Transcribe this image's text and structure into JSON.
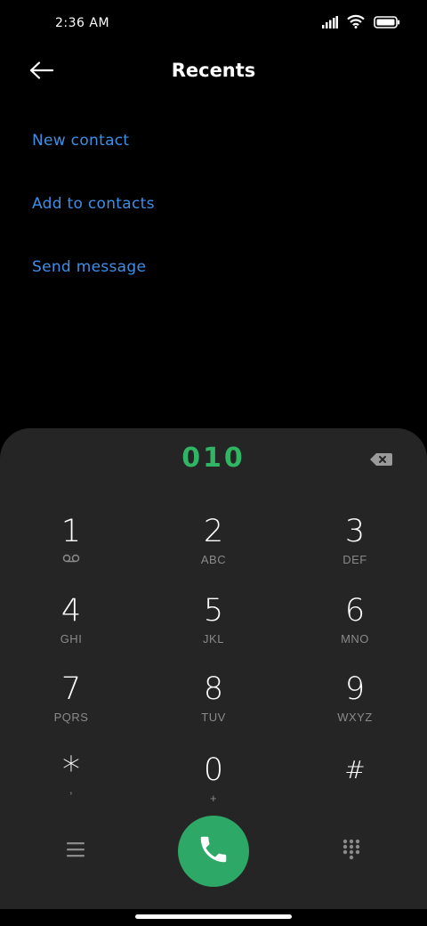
{
  "status_bar": {
    "time": "2:36 AM"
  },
  "header": {
    "title": "Recents"
  },
  "actions": {
    "new_contact": "New contact",
    "add_to_contacts": "Add to contacts",
    "send_message": "Send message"
  },
  "dialer": {
    "number": "010",
    "keys": [
      {
        "digit": "1",
        "sub": ""
      },
      {
        "digit": "2",
        "sub": "ABC"
      },
      {
        "digit": "3",
        "sub": "DEF"
      },
      {
        "digit": "4",
        "sub": "GHI"
      },
      {
        "digit": "5",
        "sub": "JKL"
      },
      {
        "digit": "6",
        "sub": "MNO"
      },
      {
        "digit": "7",
        "sub": "PQRS"
      },
      {
        "digit": "8",
        "sub": "TUV"
      },
      {
        "digit": "9",
        "sub": "WXYZ"
      },
      {
        "digit": "*",
        "sub": ","
      },
      {
        "digit": "0",
        "sub": "+"
      },
      {
        "digit": "#",
        "sub": ""
      }
    ]
  },
  "icons": {
    "back": "arrow-left-icon",
    "backspace": "backspace-icon",
    "menu": "menu-icon",
    "call": "phone-icon",
    "keypad": "dialpad-icon",
    "voicemail": "voicemail-icon",
    "signal": "signal-icon",
    "wifi": "wifi-icon",
    "battery": "battery-icon"
  },
  "colors": {
    "link": "#3d8fe8",
    "number": "#2fb563",
    "call_button": "#2ea866",
    "panel": "#252525"
  }
}
